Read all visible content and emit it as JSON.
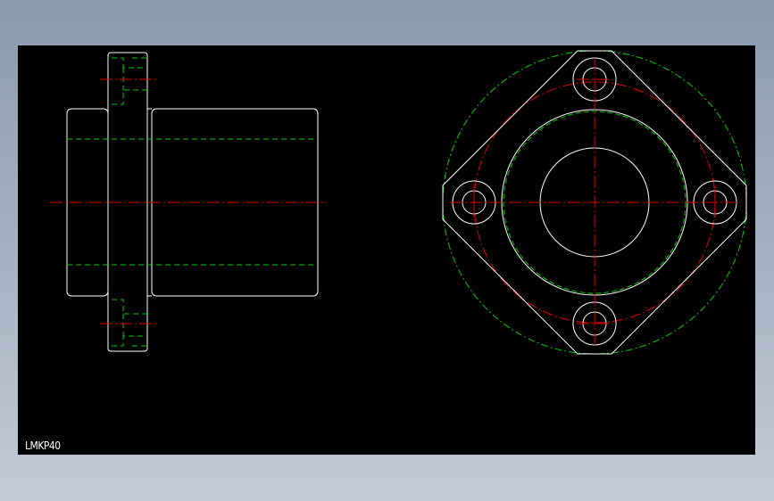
{
  "drawing": {
    "part_label": "LMKP40",
    "colors": {
      "background": "#000000",
      "outline": "#ffffff",
      "hidden_line": "#00cc00",
      "center_line": "#e00000",
      "label": "#ffffff"
    },
    "views": [
      "side-view",
      "front-view"
    ]
  }
}
